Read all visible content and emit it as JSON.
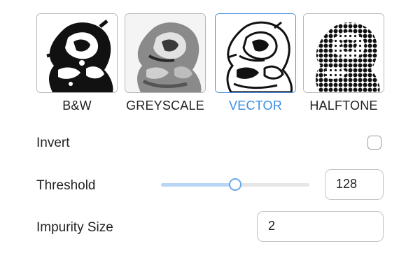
{
  "modes": [
    {
      "label": "B&W",
      "icon": "bw-preview-thumbnail",
      "selected": false
    },
    {
      "label": "GREYSCALE",
      "icon": "greyscale-preview-thumbnail",
      "selected": false
    },
    {
      "label": "VECTOR",
      "icon": "vector-preview-thumbnail",
      "selected": true
    },
    {
      "label": "HALFTONE",
      "icon": "halftone-preview-thumbnail",
      "selected": false
    }
  ],
  "options": {
    "invert_label": "Invert",
    "invert_checked": false,
    "threshold_label": "Threshold",
    "threshold_value": "128",
    "threshold_fraction": 0.5,
    "impurity_label": "Impurity Size",
    "impurity_value": "2"
  },
  "colors": {
    "accent": "#3b8de6",
    "slider_fill": "#b8d6f5",
    "border": "#c4c4c4"
  }
}
